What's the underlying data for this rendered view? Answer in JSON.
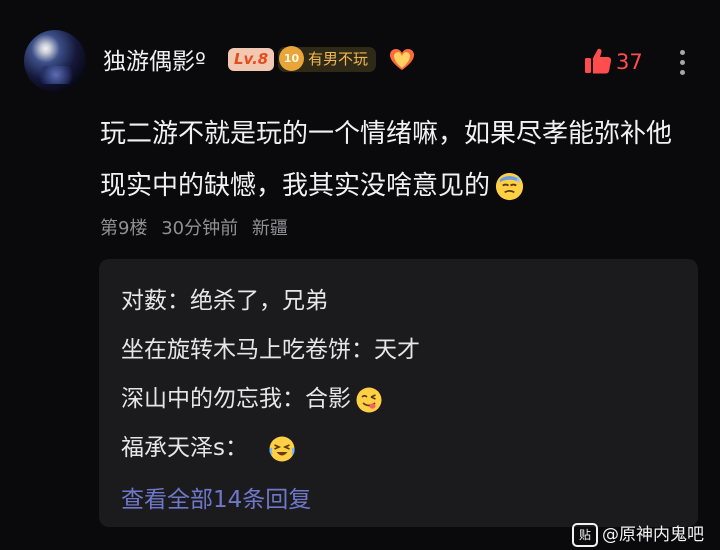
{
  "post": {
    "username": "独游偶影º",
    "level_badge": "Lv.8",
    "fan_badge": {
      "level": "10",
      "label": "有男不玩"
    },
    "likes": "37",
    "text": "玩二游不就是玩的一个情绪嘛，如果尽孝能弥补他现实中的缺憾，我其实没啥意见的",
    "meta": {
      "floor": "第9楼",
      "time": "30分钟前",
      "location": "新疆"
    }
  },
  "replies": [
    {
      "author": "对薮",
      "sep": "：",
      "text": "绝杀了，兄弟",
      "emoji": ""
    },
    {
      "author": "坐在旋转木马上吃卷饼",
      "sep": "：",
      "text": "天才",
      "emoji": ""
    },
    {
      "author": "深山中的勿忘我",
      "sep": "：",
      "text": "合影",
      "emoji": "yum-face-emoji"
    },
    {
      "author": "福承天泽s",
      "sep": "：",
      "text": "",
      "emoji": "laughing-crying-emoji"
    }
  ],
  "view_all": "查看全部14条回复",
  "watermark": {
    "logo": "贴",
    "text": "@原神内鬼吧"
  },
  "colors": {
    "background": "#0a0a0c",
    "like_accent": "#ff4d4d",
    "link": "#6f78c8",
    "level_badge_text": "#e14e20",
    "fan_badge_text": "#f2b84f"
  }
}
